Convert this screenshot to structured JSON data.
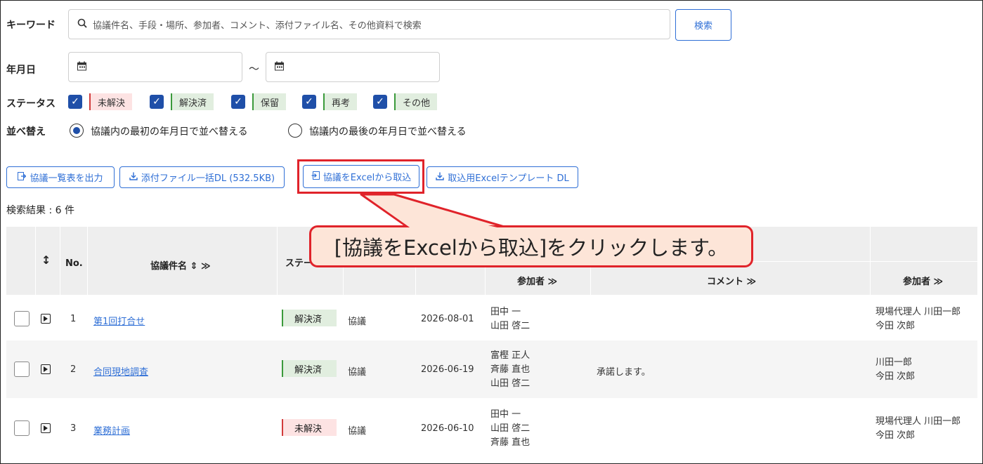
{
  "search": {
    "keyword_label": "キーワード",
    "keyword_placeholder": "協議件名、手段・場所、参加者、コメント、添付ファイル名、その他資料で検索",
    "search_button": "検索",
    "date_label": "年月日",
    "date_sep": "～",
    "status_label": "ステータス",
    "statuses": [
      "未解決",
      "解決済",
      "保留",
      "再考",
      "その他"
    ],
    "sort_label": "並べ替え",
    "sort_options": [
      "協議内の最初の年月日で並べ替える",
      "協議内の最後の年月日で並べ替える"
    ]
  },
  "actions": {
    "export_list": "協議一覧表を出力",
    "download_attachments": "添付ファイル一括DL (532.5KB)",
    "import_excel": "協議をExcelから取込",
    "download_template": "取込用Excelテンプレート DL"
  },
  "result_text": "検索結果 : 6 件",
  "table": {
    "headers": {
      "sort_icon": "↕",
      "no": "No.",
      "title": "協議件名 ⇕ ≫",
      "status": "ステー",
      "participants": "参加者 ≫",
      "comment": "コメント ≫",
      "participants2": "参加者 ≫"
    },
    "rows": [
      {
        "no": "1",
        "title": "第1回打合せ",
        "status": "解決済",
        "status_color": "green",
        "type": "協議",
        "date": "2026-08-01",
        "participants": [
          "田中 一",
          "山田 啓二"
        ],
        "comment": "",
        "participants2": [
          "現場代理人 川田一郎",
          "今田 次郎"
        ]
      },
      {
        "no": "2",
        "title": "合同現地調査",
        "status": "解決済",
        "status_color": "green",
        "type": "協議",
        "date": "2026-06-19",
        "participants": [
          "富樫 正人",
          "斉藤 直也",
          "山田 啓二"
        ],
        "comment": "承諾します。",
        "participants2": [
          "川田一郎",
          "今田 次郎"
        ]
      },
      {
        "no": "3",
        "title": "業務計画",
        "status": "未解決",
        "status_color": "red",
        "type": "協議",
        "date": "2026-06-10",
        "participants": [
          "田中 一",
          "山田 啓二",
          "斉藤 直也"
        ],
        "comment": "",
        "participants2": [
          "現場代理人 川田一郎",
          "今田 次郎"
        ]
      }
    ]
  },
  "callout": "[協議をExcelから取込]をクリックします。",
  "colors": {
    "accent": "#2f6fd6",
    "highlight": "#e0232a",
    "callout_bg": "#fde5d8"
  }
}
